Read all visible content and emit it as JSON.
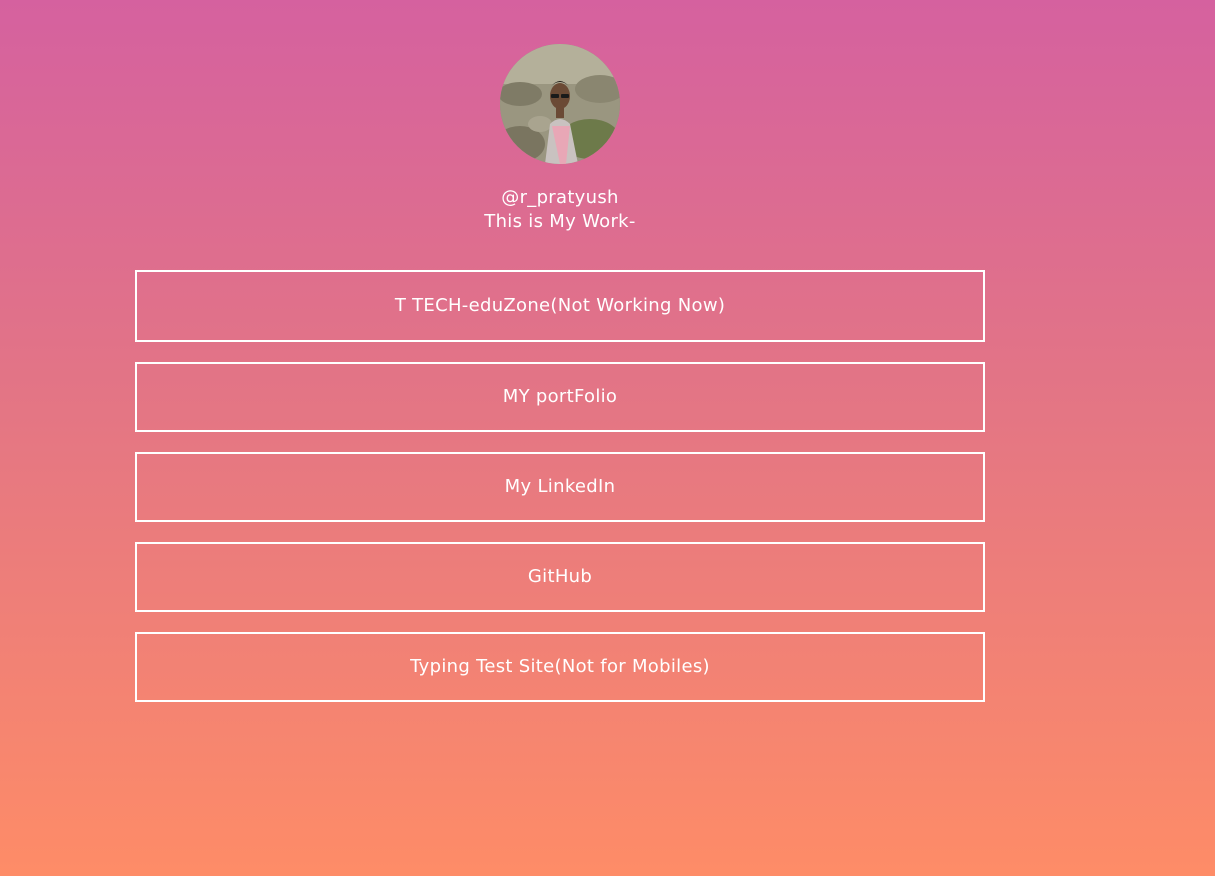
{
  "profile": {
    "handle": "@r_pratyush",
    "tagline": "This is My Work-",
    "avatar_alt": "profile photo"
  },
  "links": [
    {
      "label": "T TECH-eduZone(Not Working Now)"
    },
    {
      "label": "MY portFolio"
    },
    {
      "label": "My LinkedIn"
    },
    {
      "label": "GitHub"
    },
    {
      "label": "Typing Test Site(Not for Mobiles)"
    }
  ],
  "colors": {
    "gradient_top": "#d5619f",
    "gradient_bottom": "#fe8c67",
    "text": "#ffffff",
    "border": "#ffffff"
  }
}
